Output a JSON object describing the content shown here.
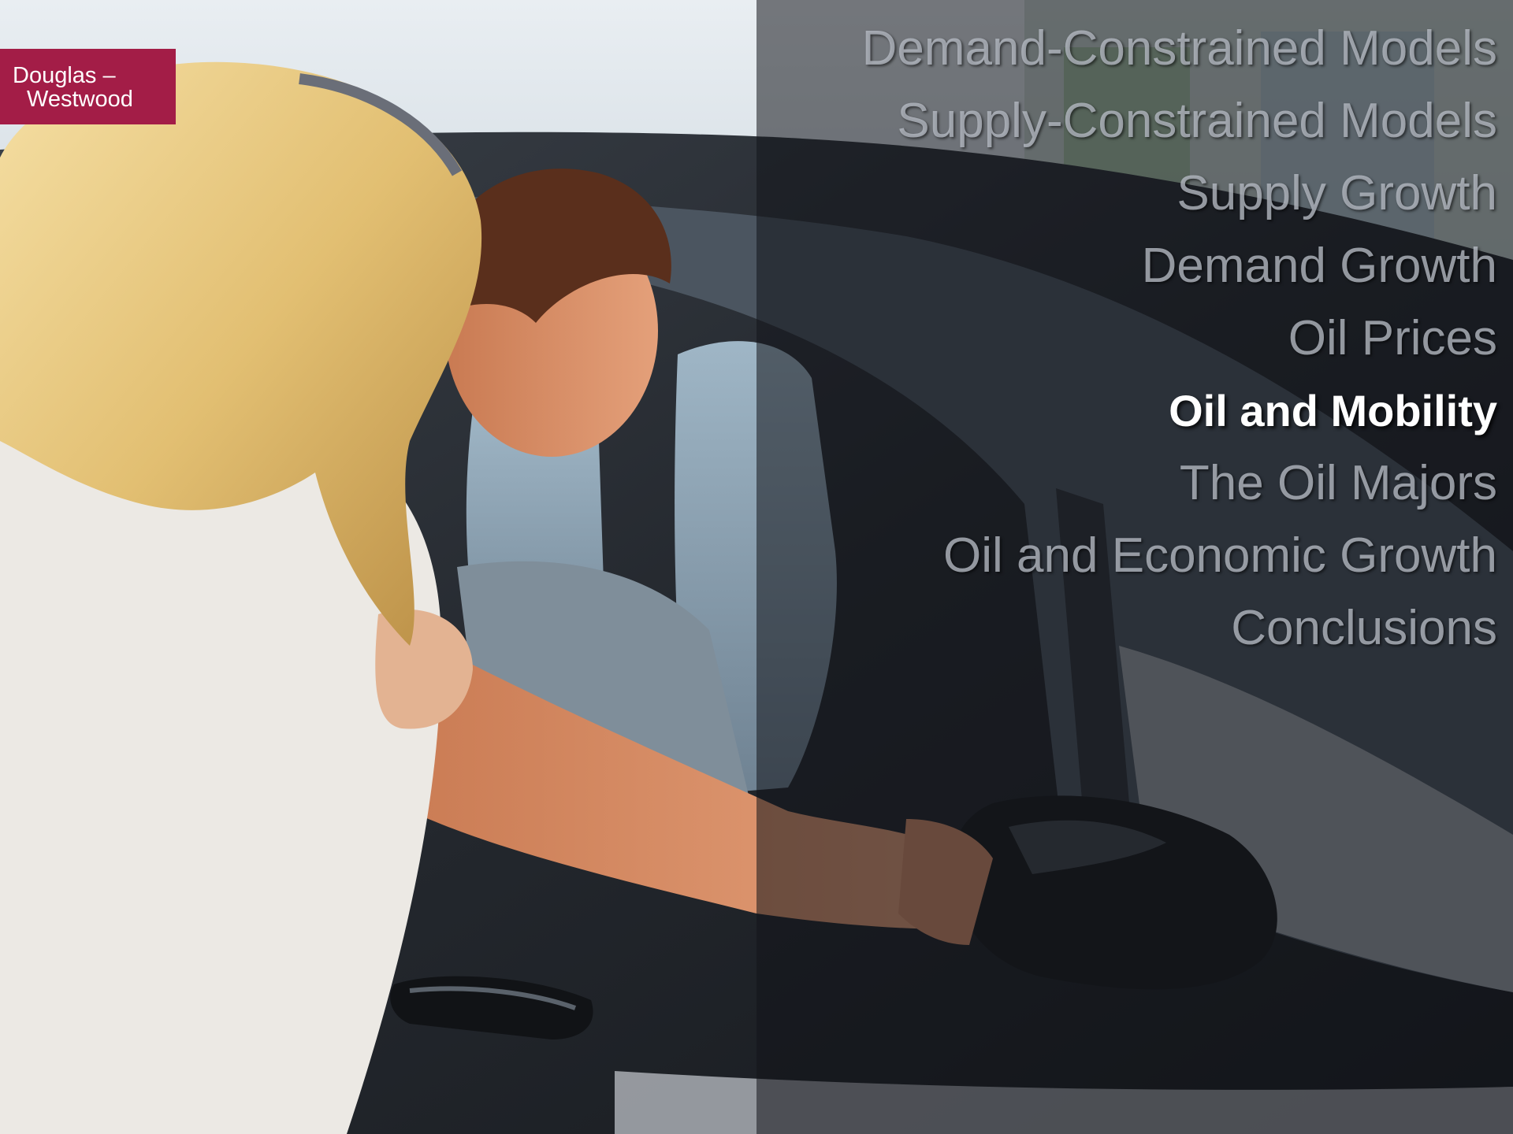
{
  "logo": {
    "line1": "Douglas –",
    "line2": "Westwood",
    "color": "#a31d47"
  },
  "agenda": {
    "items": [
      {
        "label": "Demand-Constrained Models",
        "active": false
      },
      {
        "label": "Supply-Constrained Models",
        "active": false
      },
      {
        "label": "Supply Growth",
        "active": false
      },
      {
        "label": "Demand Growth",
        "active": false
      },
      {
        "label": "Oil Prices",
        "active": false
      },
      {
        "label": "Oil and Mobility",
        "active": true
      },
      {
        "label": "The Oil Majors",
        "active": false
      },
      {
        "label": "Oil and Economic Growth",
        "active": false
      },
      {
        "label": "Conclusions",
        "active": false
      }
    ]
  },
  "background": {
    "description_icon": "couple-inspecting-car-photo"
  }
}
